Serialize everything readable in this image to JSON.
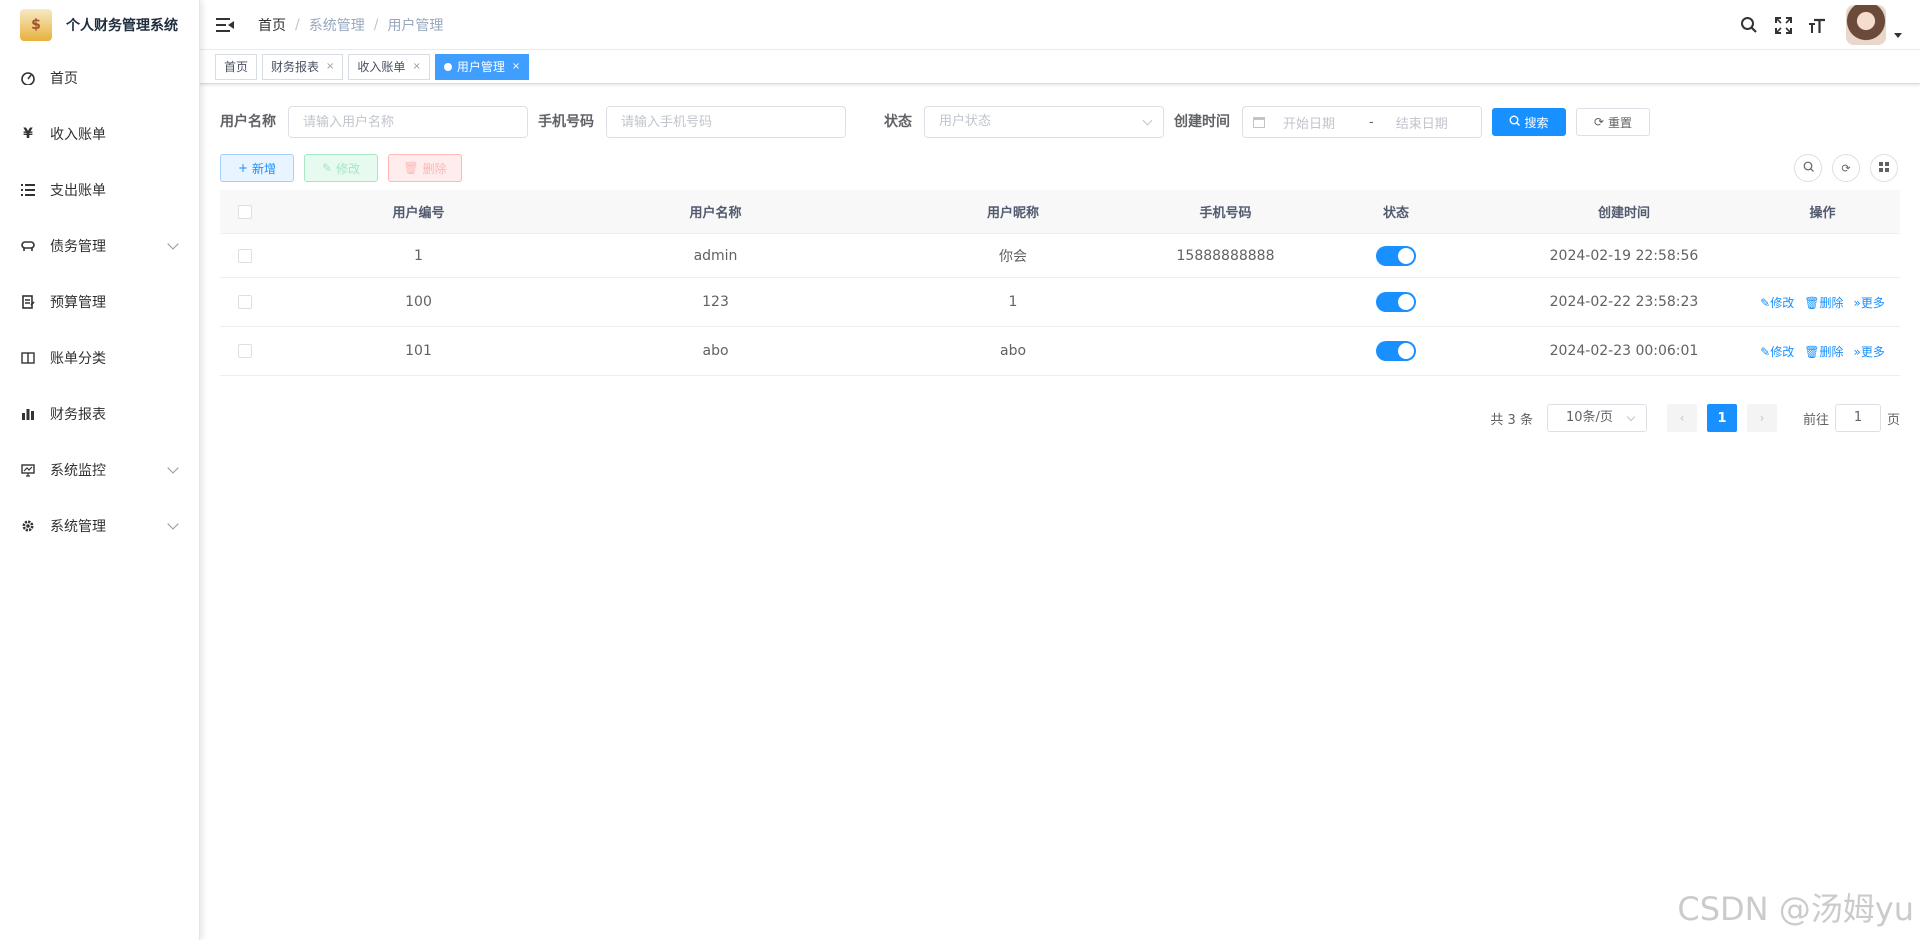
{
  "app": {
    "title": "个人财务管理系统"
  },
  "sidebar": {
    "items": [
      {
        "label": "首页",
        "icon": "dashboard-icon"
      },
      {
        "label": "收入账单",
        "icon": "yen-icon"
      },
      {
        "label": "支出账单",
        "icon": "list-icon"
      },
      {
        "label": "债务管理",
        "icon": "debt-icon",
        "submenu": true
      },
      {
        "label": "预算管理",
        "icon": "budget-icon"
      },
      {
        "label": "账单分类",
        "icon": "category-icon"
      },
      {
        "label": "财务报表",
        "icon": "chart-icon"
      },
      {
        "label": "系统监控",
        "icon": "monitor-icon",
        "submenu": true
      },
      {
        "label": "系统管理",
        "icon": "gear-icon",
        "submenu": true
      }
    ]
  },
  "breadcrumb": [
    "首页",
    "系统管理",
    "用户管理"
  ],
  "tags": [
    {
      "label": "首页",
      "closable": false,
      "active": false
    },
    {
      "label": "财务报表",
      "closable": true,
      "active": false
    },
    {
      "label": "收入账单",
      "closable": true,
      "active": false
    },
    {
      "label": "用户管理",
      "closable": true,
      "active": true
    }
  ],
  "search": {
    "username_label": "用户名称",
    "username_placeholder": "请输入用户名称",
    "phone_label": "手机号码",
    "phone_placeholder": "请输入手机号码",
    "status_label": "状态",
    "status_placeholder": "用户状态",
    "created_label": "创建时间",
    "start_placeholder": "开始日期",
    "range_sep": "-",
    "end_placeholder": "结束日期",
    "search_btn": "搜索",
    "reset_btn": "重置"
  },
  "toolbar": {
    "add": "新增",
    "edit": "修改",
    "delete": "删除"
  },
  "table": {
    "headers": [
      "用户编号",
      "用户名称",
      "用户昵称",
      "手机号码",
      "状态",
      "创建时间",
      "操作"
    ],
    "rows": [
      {
        "id": "1",
        "username": "admin",
        "nickname": "你会",
        "phone": "15888888888",
        "status": true,
        "created": "2024-02-19 22:58:56",
        "ops": []
      },
      {
        "id": "100",
        "username": "123",
        "nickname": "1",
        "phone": "",
        "status": true,
        "created": "2024-02-22 23:58:23",
        "ops": [
          "修改",
          "删除",
          "更多"
        ]
      },
      {
        "id": "101",
        "username": "abo",
        "nickname": "abo",
        "phone": "",
        "status": true,
        "created": "2024-02-23 00:06:01",
        "ops": [
          "修改",
          "删除",
          "更多"
        ]
      }
    ]
  },
  "pagination": {
    "total_text": "共 3 条",
    "page_size": "10条/页",
    "current": "1",
    "goto_label": "前往",
    "goto_value": "1",
    "page_unit": "页"
  },
  "watermark": "CSDN @汤姆yu",
  "colors": {
    "primary": "#1890ff",
    "tag_active": "#409eff"
  }
}
